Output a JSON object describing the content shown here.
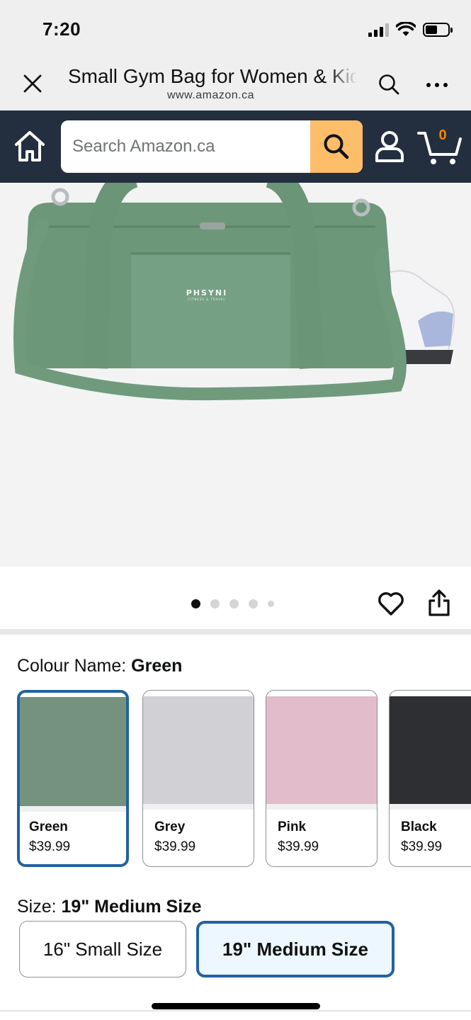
{
  "status_bar": {
    "time": "7:20"
  },
  "browser": {
    "title": "Small Gym Bag for Women & Kids",
    "url": "www.amazon.ca"
  },
  "amazon_bar": {
    "search_placeholder": "Search Amazon.ca",
    "cart_count": "0"
  },
  "product_image": {
    "brand_mark": "PHSYNI",
    "brand_tagline": "FITNESS & TRAVEL"
  },
  "carousel": {
    "dot_count": 5,
    "active_index": 0
  },
  "colour": {
    "label": "Colour Name: ",
    "selected": "Green",
    "options": [
      {
        "name": "Green",
        "price": "$39.99",
        "color": "#74927e"
      },
      {
        "name": "Grey",
        "price": "$39.99",
        "color": "#d1d0d4"
      },
      {
        "name": "Pink",
        "price": "$39.99",
        "color": "#e3bccb"
      },
      {
        "name": "Black",
        "price": "$39.99",
        "color": "#2e2f33"
      }
    ]
  },
  "size": {
    "label": "Size: ",
    "selected": "19\" Medium Size",
    "options": [
      {
        "label": "16\" Small Size"
      },
      {
        "label": "19\" Medium Size"
      }
    ]
  },
  "colors": {
    "nav_bg": "#232f3e",
    "search_button": "#febd69",
    "cart_count": "#f08804",
    "selected_border": "#2162a1",
    "selected_bg": "#edf7ff"
  }
}
